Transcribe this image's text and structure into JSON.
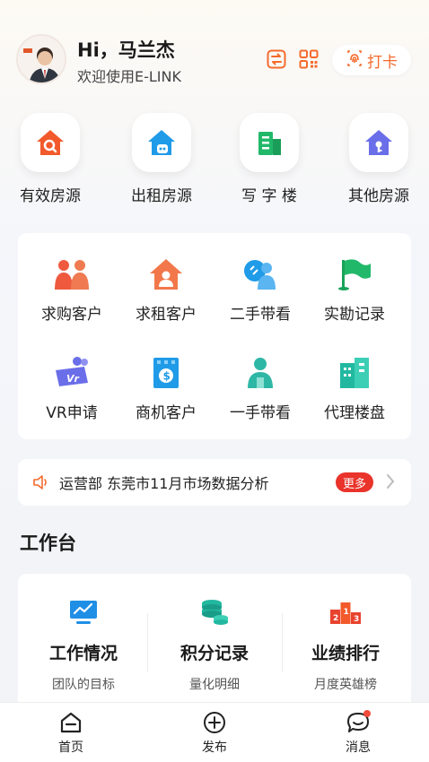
{
  "header": {
    "greeting": "Hi，马兰杰",
    "welcome": "欢迎使用E-LINK",
    "clock_in_label": "打卡",
    "icons": [
      "switch-icon",
      "qrcode-icon",
      "fingerprint-icon"
    ]
  },
  "categories": [
    {
      "label": "有效房源",
      "icon": "house-search-icon",
      "color": "#f25a2b"
    },
    {
      "label": "出租房源",
      "icon": "house-rent-icon",
      "color": "#1f9be8"
    },
    {
      "label": "写 字 楼",
      "icon": "office-building-icon",
      "color": "#22b86a"
    },
    {
      "label": "其他房源",
      "icon": "house-key-icon",
      "color": "#6a6ee8"
    }
  ],
  "grid": [
    {
      "label": "求购客户",
      "icon": "buyer-customers-icon"
    },
    {
      "label": "求租客户",
      "icon": "renter-customer-icon"
    },
    {
      "label": "二手带看",
      "icon": "second-hand-viewing-icon"
    },
    {
      "label": "实勘记录",
      "icon": "survey-flag-icon"
    },
    {
      "label": "VR申请",
      "icon": "vr-icon"
    },
    {
      "label": "商机客户",
      "icon": "business-customer-icon"
    },
    {
      "label": "一手带看",
      "icon": "first-hand-viewing-icon"
    },
    {
      "label": "代理楼盘",
      "icon": "agency-buildings-icon"
    }
  ],
  "notice": {
    "text": "运营部 东莞市11月市场数据分析",
    "more_label": "更多"
  },
  "workbench": {
    "title": "工作台",
    "items": [
      {
        "title": "工作情况",
        "subtitle": "团队的目标",
        "icon": "monitor-chart-icon"
      },
      {
        "title": "积分记录",
        "subtitle": "量化明细",
        "icon": "coins-icon"
      },
      {
        "title": "业绩排行",
        "subtitle": "月度英雄榜",
        "icon": "podium-icon"
      }
    ]
  },
  "bottom_nav": [
    {
      "label": "首页",
      "icon": "home-icon"
    },
    {
      "label": "发布",
      "icon": "plus-circle-icon"
    },
    {
      "label": "消息",
      "icon": "chat-icon"
    }
  ]
}
